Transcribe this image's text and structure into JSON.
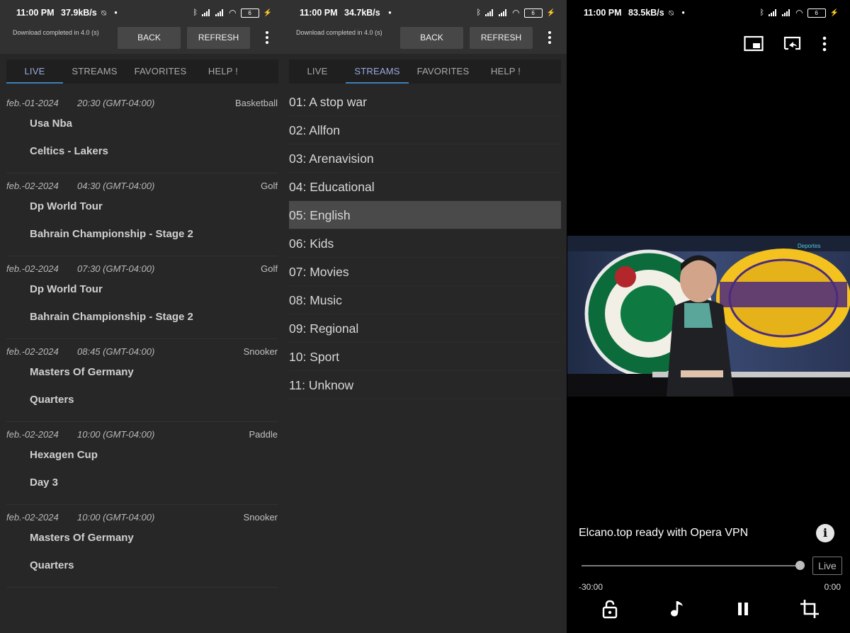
{
  "panel1": {
    "status": {
      "time": "11:00 PM",
      "speed": "37.9kB/s",
      "battery": "6"
    },
    "toolbar": {
      "message": "Download completed in 4.0 (s)",
      "back": "BACK",
      "refresh": "REFRESH"
    },
    "tabs": [
      "LIVE",
      "STREAMS",
      "FAVORITES",
      "HELP !"
    ],
    "active_tab": "LIVE",
    "events": [
      {
        "date": "feb.-01-2024",
        "time": "20:30 (GMT-04:00)",
        "sport": "Basketball",
        "league": "Usa Nba",
        "match": "Celtics - Lakers"
      },
      {
        "date": "feb.-02-2024",
        "time": "04:30 (GMT-04:00)",
        "sport": "Golf",
        "league": "Dp World Tour",
        "match": "Bahrain Championship - Stage 2"
      },
      {
        "date": "feb.-02-2024",
        "time": "07:30 (GMT-04:00)",
        "sport": "Golf",
        "league": "Dp World Tour",
        "match": "Bahrain Championship - Stage 2"
      },
      {
        "date": "feb.-02-2024",
        "time": "08:45 (GMT-04:00)",
        "sport": "Snooker",
        "league": "Masters Of Germany",
        "match": "Quarters"
      },
      {
        "date": "feb.-02-2024",
        "time": "10:00 (GMT-04:00)",
        "sport": "Paddle",
        "league": "Hexagen Cup",
        "match": "Day 3"
      },
      {
        "date": "feb.-02-2024",
        "time": "10:00 (GMT-04:00)",
        "sport": "Snooker",
        "league": "Masters Of Germany",
        "match": "Quarters"
      }
    ]
  },
  "panel2": {
    "status": {
      "time": "11:00 PM",
      "speed": "34.7kB/s",
      "battery": "6"
    },
    "toolbar": {
      "message": "Download completed in 4.0 (s)",
      "back": "BACK",
      "refresh": "REFRESH"
    },
    "tabs": [
      "LIVE",
      "STREAMS",
      "FAVORITES",
      "HELP !"
    ],
    "active_tab": "STREAMS",
    "streams": [
      "01: A stop war",
      "02: Allfon",
      "03: Arenavision",
      "04: Educational",
      "05: English",
      "06: Kids",
      "07: Movies",
      "08: Music",
      "09: Regional",
      "10: Sport",
      "11: Unknow"
    ],
    "selected_stream": "05: English"
  },
  "panel3": {
    "status": {
      "time": "11:00 PM",
      "speed": "83.5kB/s",
      "battery": "6"
    },
    "top_icons": [
      "picture-in-picture-icon",
      "cast-icon",
      "more-vert-icon"
    ],
    "video": {
      "logo_left": "BOSTON CELTICS",
      "logo_right": "LOS ANGELES LAKERS",
      "channel": "Deportes"
    },
    "title": "Elcano.top ready with Opera VPN",
    "live_label": "Live",
    "time_left": "-30:00",
    "time_right": "0:00",
    "progress": 1.0,
    "controls": [
      "lock-icon",
      "music-note-icon",
      "pause-icon",
      "crop-icon"
    ]
  },
  "colors": {
    "panel_bg": "#272727",
    "toolbar_bg": "#313131",
    "button_bg": "#474747",
    "tab_accent": "#3f7fb8",
    "selected_row": "#4a4a4a"
  }
}
